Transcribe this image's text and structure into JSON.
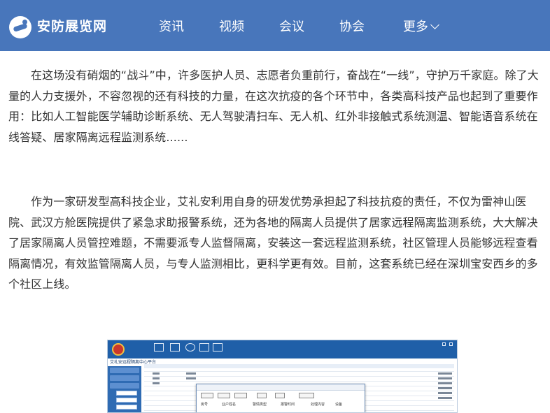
{
  "header": {
    "brand": "安防展览网",
    "nav": [
      {
        "label": "资讯"
      },
      {
        "label": "视频"
      },
      {
        "label": "会议"
      },
      {
        "label": "协会"
      },
      {
        "label": "更多"
      }
    ],
    "background_color": "#4876bb"
  },
  "article": {
    "paragraph_1": "在这场没有硝烟的“战斗”中，许多医护人员、志愿者负重前行，奋战在“一线”，守护万千家庭。除了大量的人力支援外，不容忽视的还有科技的力量，在这次抗疫的各个环节中，各类高科技产品也起到了重要作用：比如人工智能医学辅助诊断系统、无人驾驶清扫车、无人机、红外非接触式系统测温、智能语音系统在线答疑、居家隔离远程监测系统......",
    "paragraph_2": "作为一家研发型高科技企业，艾礼安利用自身的研发优势承担起了科技抗疫的责任，不仅为雷神山医院、武汉方舱医院提供了紧急求助报警系统，还为各地的隔离人员提供了居家远程隔离监测系统，大大解决了居家隔离人员管控难题，不需要派专人监督隔离，安装这一套远程监测系统，社区管理人员能够远程查看隔离情况，有效监管隔离人员，与专人监测相比，更科学更有效。目前，这套系统已经在深圳宝安西乡的多个社区上线。"
  },
  "screenshot": {
    "system_title": "艾礼安远程隔离中心平台",
    "toolbar_labels": [
      "",
      "",
      "",
      ""
    ],
    "dialog_headers": [
      "房号",
      "业户姓名",
      "警情类型",
      "报警时间",
      "处理内容",
      "设备"
    ],
    "dialog_values": [
      "",
      "",
      "",
      "",
      "",
      ""
    ]
  }
}
